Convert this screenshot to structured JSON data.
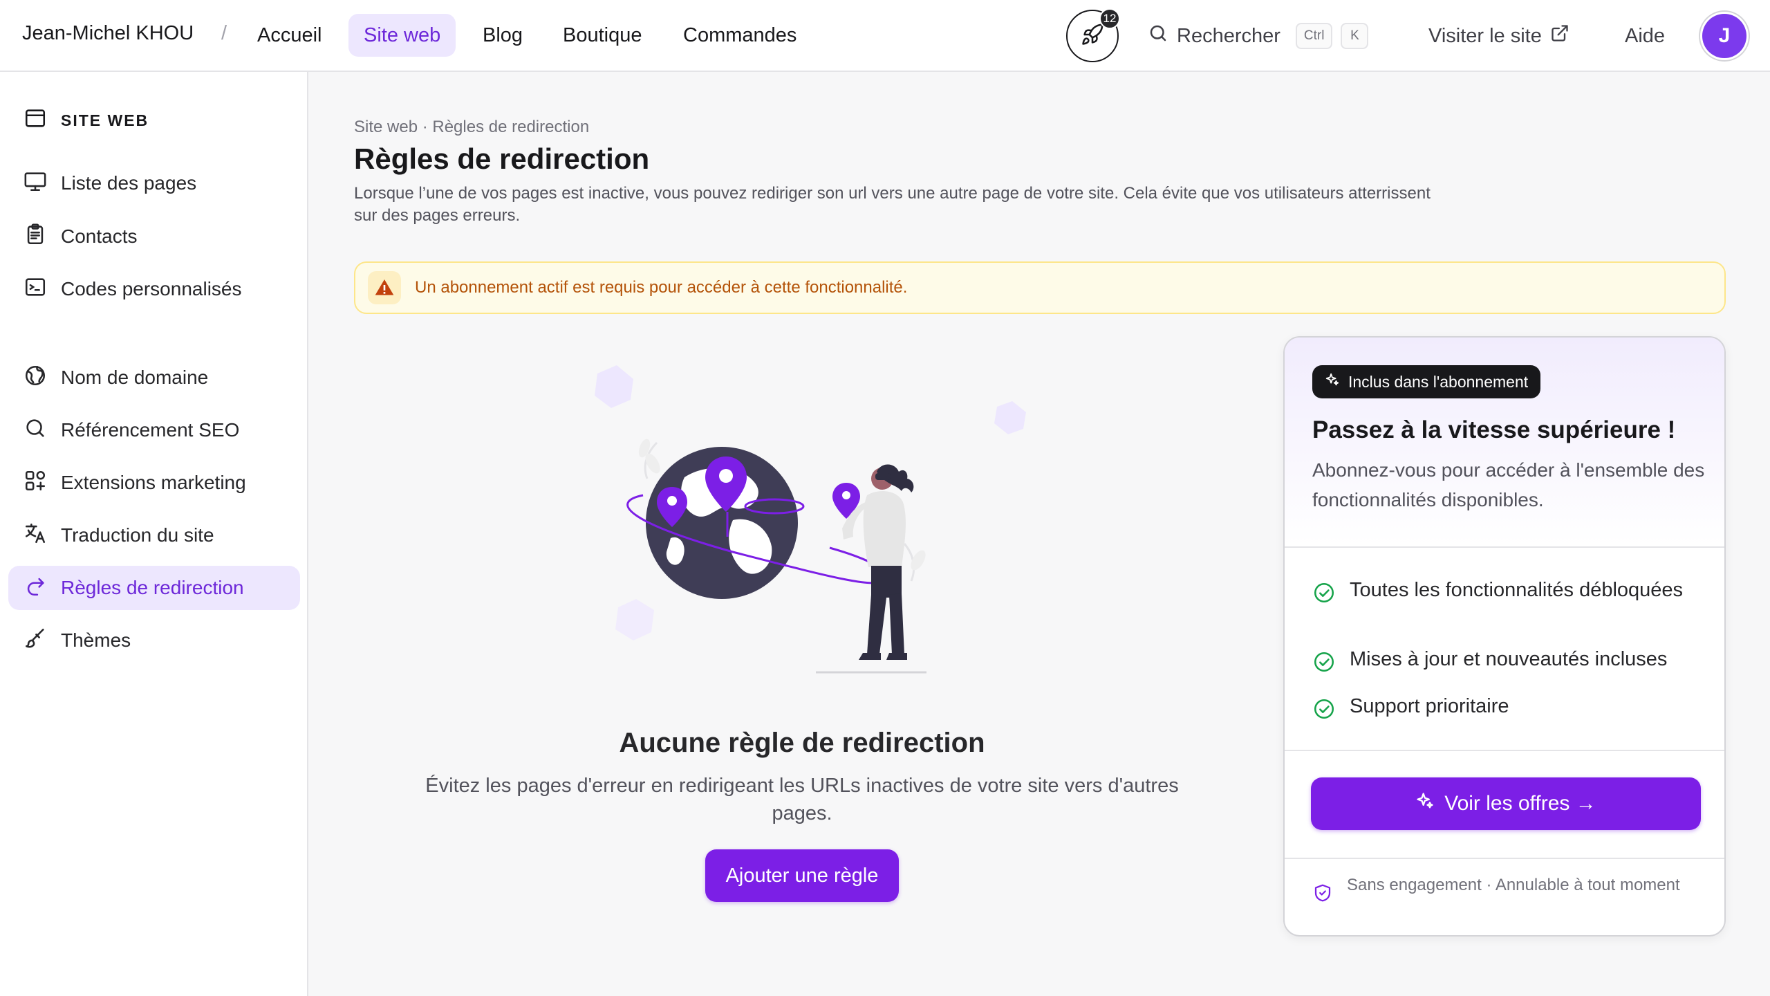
{
  "header": {
    "user_name": "Jean-Michel KHOU",
    "separator": "/",
    "nav": [
      {
        "label": "Accueil"
      },
      {
        "label": "Site web"
      },
      {
        "label": "Blog"
      },
      {
        "label": "Boutique"
      },
      {
        "label": "Commandes"
      }
    ],
    "notif_count": "12",
    "search_label": "Rechercher",
    "kbd_ctrl": "Ctrl",
    "kbd_k": "K",
    "visit_label": "Visiter le site",
    "help_label": "Aide",
    "avatar_initial": "J"
  },
  "sidebar": {
    "section_title": "SITE WEB",
    "items": [
      {
        "label": "Liste des pages",
        "icon": "monitor-icon"
      },
      {
        "label": "Contacts",
        "icon": "clipboard-icon"
      },
      {
        "label": "Codes personnalisés",
        "icon": "terminal-icon"
      },
      {
        "label": "Nom de domaine",
        "icon": "globe-icon"
      },
      {
        "label": "Référencement SEO",
        "icon": "search-icon"
      },
      {
        "label": "Extensions marketing",
        "icon": "apps-add-icon"
      },
      {
        "label": "Traduction du site",
        "icon": "translate-icon"
      },
      {
        "label": "Règles de redirection",
        "icon": "redirect-arrow-icon",
        "active": true
      },
      {
        "label": "Thèmes",
        "icon": "paintbrush-icon"
      }
    ]
  },
  "main": {
    "breadcrumb": "Site web · Règles de redirection",
    "title": "Règles de redirection",
    "description": "Lorsque l’une de vos pages est inactive, vous pouvez rediriger son url vers une autre page de votre site. Cela évite que vos utilisateurs atterrissent sur des pages erreurs.",
    "alert": "Un abonnement actif est requis pour accéder à cette fonctionnalité.",
    "empty_title": "Aucune règle de redirection",
    "empty_desc": "Évitez les pages d'erreur en redirigeant les URLs inactives de votre site vers d'autres pages.",
    "add_button": "Ajouter une règle"
  },
  "plan_card": {
    "pill": "Inclus dans l'abonnement",
    "title": "Passez à la vitesse supérieure !",
    "subtitle": "Abonnez-vous pour accéder à l'ensemble des fonctionnalités disponibles.",
    "features": [
      "Toutes les fonctionnalités débloquées",
      "Mises à jour et nouveautés incluses",
      "Support prioritaire"
    ],
    "cta": "Voir les offres →",
    "footer": "Sans engagement · Annulable à tout moment"
  },
  "colors": {
    "accent": "#7c1fe6",
    "accent_soft": "#ede7fe",
    "warning_bg": "#fefbe8",
    "warning_text": "#b45309",
    "success": "#16a34a"
  }
}
